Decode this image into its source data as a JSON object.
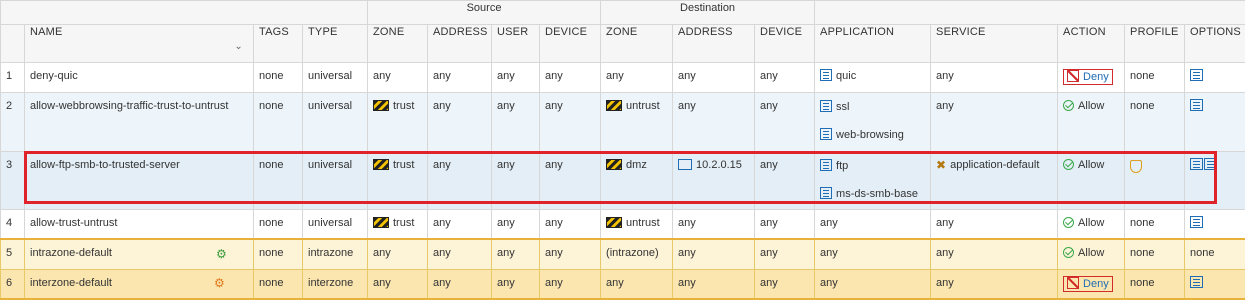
{
  "group_headers": {
    "source": "Source",
    "destination": "Destination"
  },
  "columns": {
    "name": "NAME",
    "tags": "TAGS",
    "type": "TYPE",
    "src_zone": "ZONE",
    "src_address": "ADDRESS",
    "src_user": "USER",
    "src_device": "DEVICE",
    "dst_zone": "ZONE",
    "dst_address": "ADDRESS",
    "dst_device": "DEVICE",
    "application": "APPLICATION",
    "service": "SERVICE",
    "action": "ACTION",
    "profile": "PROFILE",
    "options": "OPTIONS"
  },
  "rules": [
    {
      "num": "1",
      "name": "deny-quic",
      "tags": "none",
      "type": "universal",
      "src_zone": "any",
      "src_address": "any",
      "src_user": "any",
      "src_device": "any",
      "dst_zone": "any",
      "dst_address": "any",
      "dst_device": "any",
      "apps": [
        "quic"
      ],
      "service": "any",
      "action": "Deny",
      "profile": "none"
    },
    {
      "num": "2",
      "name": "allow-webbrowsing-traffic-trust-to-untrust",
      "tags": "none",
      "type": "universal",
      "src_zone": "trust",
      "src_address": "any",
      "src_user": "any",
      "src_device": "any",
      "dst_zone": "untrust",
      "dst_address": "any",
      "dst_device": "any",
      "apps": [
        "ssl",
        "web-browsing"
      ],
      "service": "any",
      "action": "Allow",
      "profile": "none"
    },
    {
      "num": "3",
      "name": "allow-ftp-smb-to-trusted-server",
      "tags": "none",
      "type": "universal",
      "src_zone": "trust",
      "src_address": "any",
      "src_user": "any",
      "src_device": "any",
      "dst_zone": "dmz",
      "dst_address": "10.2.0.15",
      "dst_device": "any",
      "apps": [
        "ftp",
        "ms-ds-smb-base"
      ],
      "service": "application-default",
      "action": "Allow",
      "profile": ""
    },
    {
      "num": "4",
      "name": "allow-trust-untrust",
      "tags": "none",
      "type": "universal",
      "src_zone": "trust",
      "src_address": "any",
      "src_user": "any",
      "src_device": "any",
      "dst_zone": "untrust",
      "dst_address": "any",
      "dst_device": "any",
      "apps": [
        "any"
      ],
      "service": "any",
      "action": "Allow",
      "profile": "none"
    },
    {
      "num": "5",
      "name": "intrazone-default",
      "tags": "none",
      "type": "intrazone",
      "src_zone": "any",
      "src_address": "any",
      "src_user": "any",
      "src_device": "any",
      "dst_zone": "(intrazone)",
      "dst_address": "any",
      "dst_device": "any",
      "apps": [
        "any"
      ],
      "service": "any",
      "action": "Allow",
      "profile": "none",
      "options": "none"
    },
    {
      "num": "6",
      "name": "interzone-default",
      "tags": "none",
      "type": "interzone",
      "src_zone": "any",
      "src_address": "any",
      "src_user": "any",
      "src_device": "any",
      "dst_zone": "any",
      "dst_address": "any",
      "dst_device": "any",
      "apps": [
        "any"
      ],
      "service": "any",
      "action": "Deny",
      "profile": "none"
    }
  ],
  "colors": {
    "link": "#1f6db4",
    "highlight": "#e0222a",
    "allow": "#3aa84a",
    "deny": "#d12b2b"
  }
}
